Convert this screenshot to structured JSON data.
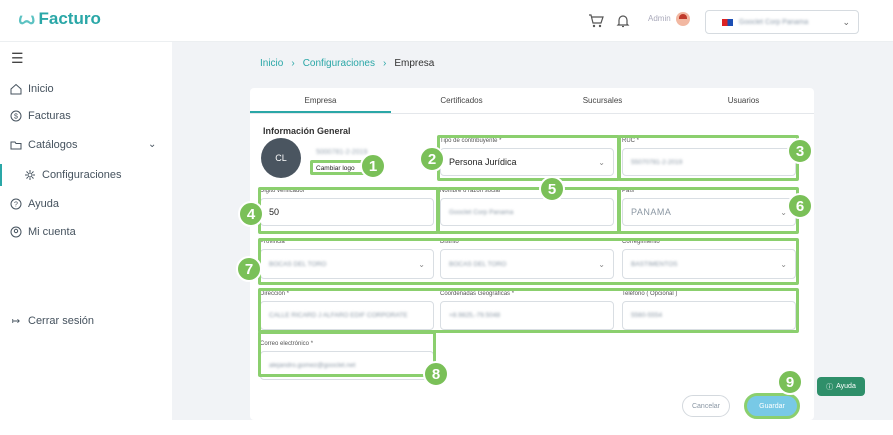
{
  "header": {
    "logo_mark": "ꙍ",
    "logo_text": "Facturo",
    "admin_label": "Admin",
    "company_name": "Gooclet Corp Panama"
  },
  "sidebar": {
    "menu_icon": "hamburger-icon",
    "items": [
      {
        "label": "Inicio",
        "icon": "home-icon"
      },
      {
        "label": "Facturas",
        "icon": "dollar-circle-icon"
      },
      {
        "label": "Catálogos",
        "icon": "folder-icon"
      },
      {
        "label": "Configuraciones",
        "icon": "gear-icon"
      },
      {
        "label": "Ayuda",
        "icon": "question-icon"
      },
      {
        "label": "Mi cuenta",
        "icon": "user-circle-icon"
      }
    ],
    "logout_label": "Cerrar sesión"
  },
  "breadcrumb": {
    "items": [
      "Inicio",
      "Configuraciones",
      "Empresa"
    ]
  },
  "tabs": [
    "Empresa",
    "Certificados",
    "Sucursales",
    "Usuarios"
  ],
  "section_title": "Información General",
  "avatar_initials": "CL",
  "avatar_blur_text": "5000781-2-2019",
  "change_logo_label": "Cambiar logo",
  "form": {
    "tipo_label": "Tipo de contribuyente *",
    "tipo_value": "Persona Jurídica",
    "ruc_label": "RUC *",
    "ruc_value": "55070781-2-2019",
    "dv_label": "Digito verificador *",
    "dv_value": "50",
    "nombre_label": "Nombre o razón social *",
    "nombre_value": "Gooclet Corp Panama",
    "pais_label": "País *",
    "pais_value": "PANAMA",
    "provincia_label": "Provincia *",
    "provincia_value": "BOCAS DEL TORO",
    "distrito_label": "Distrito *",
    "distrito_value": "BOCAS DEL TORO",
    "corregimiento_label": "Corregimiento *",
    "corregimiento_value": "BASTIMENTOS",
    "direccion_label": "Dirección *",
    "direccion_value": "CALLE RICARD J ALFARO EDIF CORPORATE",
    "coords_label": "Coordenadas Geograficas *",
    "coords_value": "+8.9825,-79.5048",
    "telefono_label": "Teléfono ( Opcional )",
    "telefono_value": "5560-5554",
    "correo_label": "Correo electrónico *",
    "correo_value": "alejandro.gomez@gooclet.net"
  },
  "buttons": {
    "cancel": "Cancelar",
    "save": "Guardar"
  },
  "help_button": "Ayuda",
  "badges": [
    "1",
    "2",
    "3",
    "4",
    "5",
    "6",
    "7",
    "8",
    "9"
  ],
  "colors": {
    "accent": "#2aa7a7",
    "highlight": "#8bcf6e",
    "badge": "#7ac058"
  }
}
